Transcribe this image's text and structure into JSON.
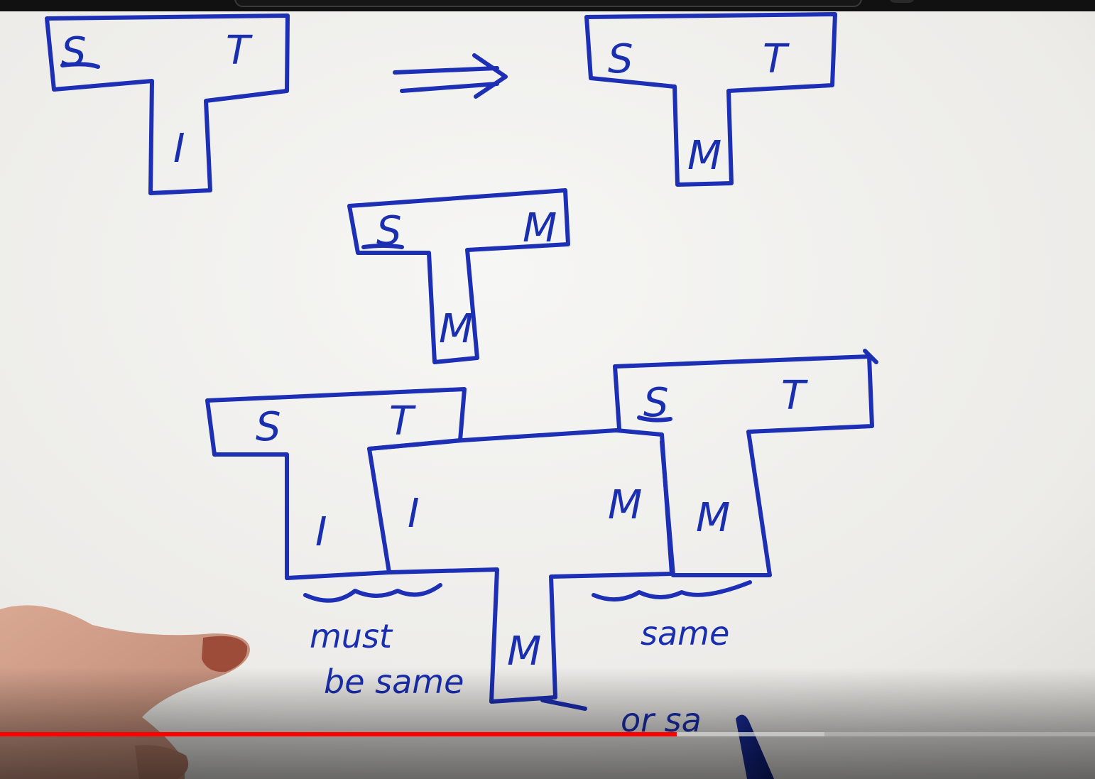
{
  "colors": {
    "ink": "#1c2fb5",
    "whiteboard": "#f2f2f0",
    "progress_played": "#ff0000"
  },
  "player": {
    "progress_played": 0.618,
    "progress_loaded": 0.753
  },
  "board": {
    "top_left_shape": {
      "left": "S",
      "right": "T",
      "stem": "I"
    },
    "arrow": "⟹",
    "top_right_shape": {
      "left": "S",
      "right": "T",
      "stem": "M"
    },
    "middle_shape": {
      "left": "S",
      "right": "M",
      "stem": "M"
    },
    "bottom_left_shape": {
      "left": "S",
      "right": "T",
      "stem": "I"
    },
    "bottom_center_shape": {
      "left": "I",
      "right": "M",
      "stem": "M"
    },
    "bottom_right_shape": {
      "left": "S",
      "right": "T",
      "stem": "M"
    },
    "note_left_1": "must",
    "note_left_2": "be same",
    "note_right": "same",
    "note_bottom": "or sa"
  }
}
